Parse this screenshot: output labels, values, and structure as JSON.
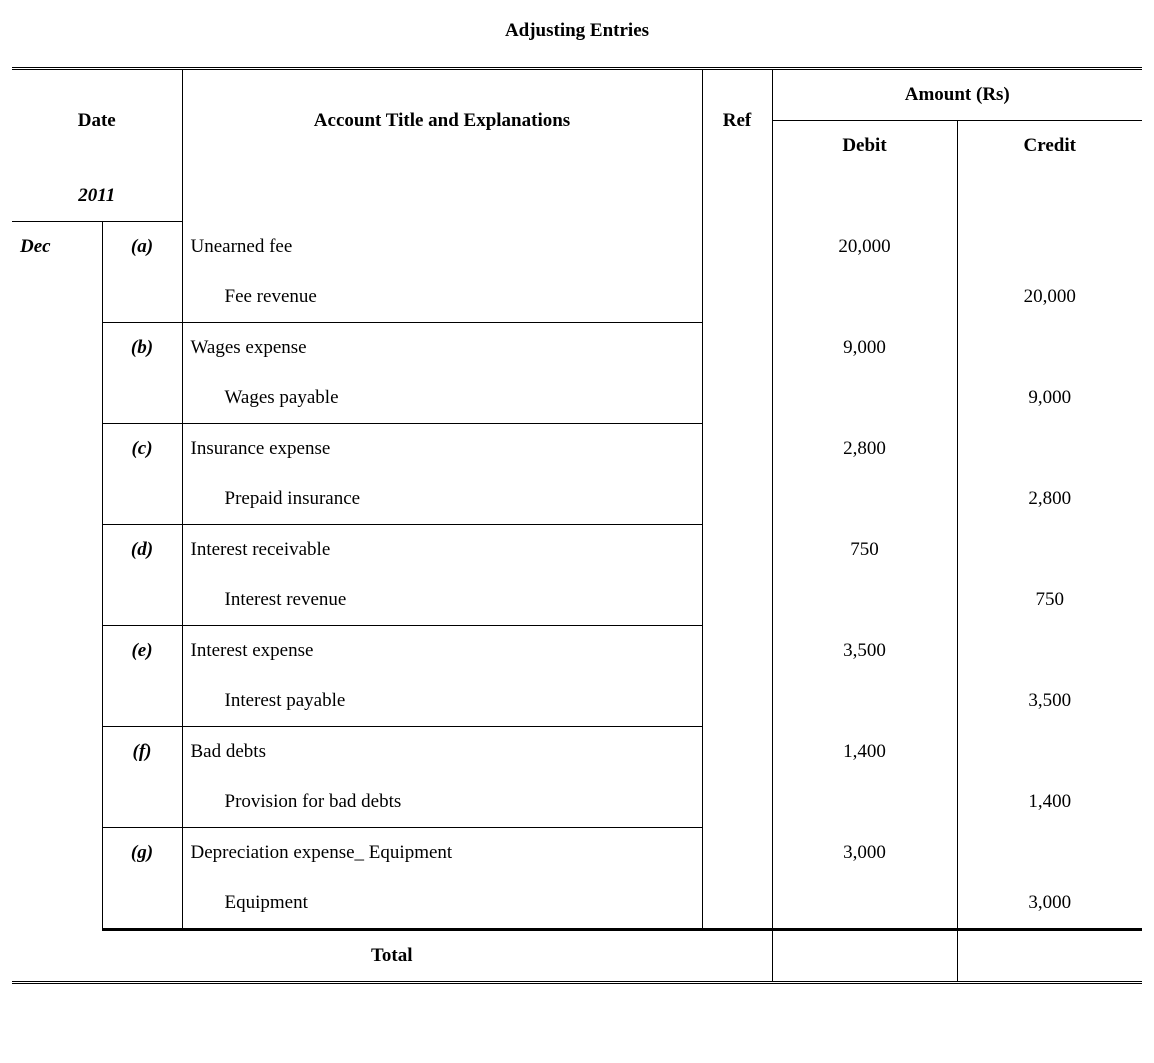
{
  "title": "Adjusting Entries",
  "headers": {
    "date": "Date",
    "account": "Account Title and Explanations",
    "ref": "Ref",
    "amount": "Amount (Rs)",
    "debit": "Debit",
    "credit": "Credit"
  },
  "year": "2011",
  "month": "Dec",
  "entries": [
    {
      "label": "(a)",
      "debit_account": "Unearned fee",
      "credit_account": "Fee revenue",
      "debit": "20,000",
      "credit": "20,000"
    },
    {
      "label": "(b)",
      "debit_account": "Wages expense",
      "credit_account": "Wages payable",
      "debit": "9,000",
      "credit": "9,000"
    },
    {
      "label": "(c)",
      "debit_account": "Insurance expense",
      "credit_account": "Prepaid insurance",
      "debit": "2,800",
      "credit": "2,800"
    },
    {
      "label": "(d)",
      "debit_account": "Interest receivable",
      "credit_account": "Interest revenue",
      "debit": "750",
      "credit": "750"
    },
    {
      "label": "(e)",
      "debit_account": "Interest expense",
      "credit_account": "Interest payable",
      "debit": "3,500",
      "credit": "3,500"
    },
    {
      "label": "(f)",
      "debit_account": "Bad debts",
      "credit_account": "Provision for bad debts",
      "debit": "1,400",
      "credit": "1,400"
    },
    {
      "label": "(g)",
      "debit_account": "Depreciation expense_ Equipment",
      "credit_account": "Equipment",
      "debit": "3,000",
      "credit": "3,000"
    }
  ],
  "total_label": "Total",
  "chart_data": {
    "type": "table",
    "title": "Adjusting Entries",
    "columns": [
      "Date",
      "Label",
      "Account Title and Explanations",
      "Ref",
      "Debit",
      "Credit"
    ],
    "year": 2011,
    "month": "Dec",
    "rows": [
      {
        "label": "(a)",
        "debit_account": "Unearned fee",
        "credit_account": "Fee revenue",
        "debit": 20000,
        "credit": 20000
      },
      {
        "label": "(b)",
        "debit_account": "Wages expense",
        "credit_account": "Wages payable",
        "debit": 9000,
        "credit": 9000
      },
      {
        "label": "(c)",
        "debit_account": "Insurance expense",
        "credit_account": "Prepaid insurance",
        "debit": 2800,
        "credit": 2800
      },
      {
        "label": "(d)",
        "debit_account": "Interest receivable",
        "credit_account": "Interest revenue",
        "debit": 750,
        "credit": 750
      },
      {
        "label": "(e)",
        "debit_account": "Interest expense",
        "credit_account": "Interest payable",
        "debit": 3500,
        "credit": 3500
      },
      {
        "label": "(f)",
        "debit_account": "Bad debts",
        "credit_account": "Provision for bad debts",
        "debit": 1400,
        "credit": 1400
      },
      {
        "label": "(g)",
        "debit_account": "Depreciation expense_ Equipment",
        "credit_account": "Equipment",
        "debit": 3000,
        "credit": 3000
      }
    ]
  }
}
